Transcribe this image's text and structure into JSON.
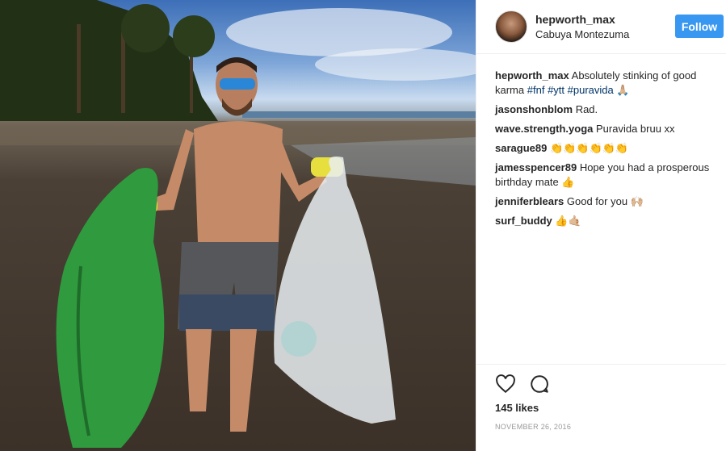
{
  "header": {
    "username": "hepworth_max",
    "location": "Cabuya Montezuma",
    "follow_label": "Follow"
  },
  "caption": {
    "username": "hepworth_max",
    "text": "Absolutely stinking of good karma",
    "tags": [
      "#fnf",
      "#ytt",
      "#puravida"
    ],
    "emoji": "🙏🏼"
  },
  "comments": [
    {
      "username": "jasonshonblom",
      "text": "Rad."
    },
    {
      "username": "wave.strength.yoga",
      "text": "Puravida bruu xx"
    },
    {
      "username": "sarague89",
      "text": "👏👏👏👏👏👏"
    },
    {
      "username": "jamesspencer89",
      "text": "Hope you had a prosperous birthday mate 👍"
    },
    {
      "username": "jenniferblears",
      "text": "Good for you 🙌🏼"
    },
    {
      "username": "surf_buddy",
      "text": "👍🤙🏼"
    }
  ],
  "actions": {
    "likes": "145 likes",
    "date": "NOVEMBER 26, 2016"
  },
  "icons": {
    "like": "heart-icon",
    "comment": "comment-bubble-icon"
  },
  "colors": {
    "follow_button": "#3897f0",
    "hashtag": "#003569",
    "date": "#999999"
  }
}
